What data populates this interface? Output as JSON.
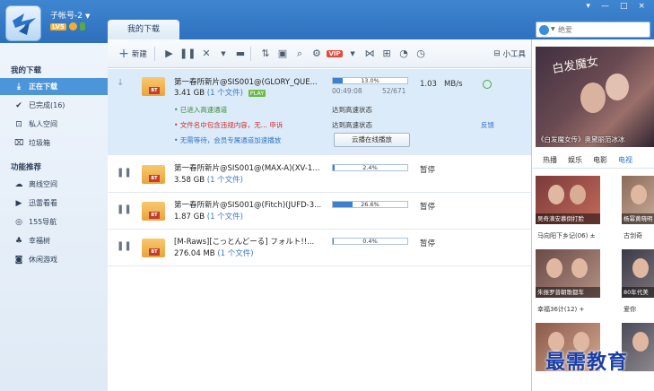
{
  "account": {
    "name": "子帐号-2",
    "level_badge": "LV5"
  },
  "window_controls": [
    "▾",
    "—",
    "□",
    "×"
  ],
  "main_tab": "我的下载",
  "search": {
    "placeholder": "绝爱"
  },
  "sidebar": {
    "section1_title": "我的下载",
    "items1": [
      {
        "label": "正在下载",
        "icon": "download-icon",
        "active": true
      },
      {
        "label": "已完成(16)",
        "icon": "check-icon",
        "active": false
      },
      {
        "label": "私人空间",
        "icon": "lock-icon",
        "active": false
      },
      {
        "label": "垃圾箱",
        "icon": "trash-icon",
        "active": false
      }
    ],
    "section2_title": "功能推荐",
    "items2": [
      {
        "label": "离线空间",
        "icon": "cloud-icon"
      },
      {
        "label": "迅雷看看",
        "icon": "play-circle-icon"
      },
      {
        "label": "155导航",
        "icon": "navigation-icon"
      },
      {
        "label": "幸福树",
        "icon": "tree-icon"
      },
      {
        "label": "休闲游戏",
        "icon": "gamepad-icon"
      }
    ]
  },
  "toolbar": {
    "new_label": "新建",
    "tools_label": "小工具",
    "vip_label": "VIP"
  },
  "downloads": [
    {
      "name": "第一春所新片@SIS001@(GLORY_QUE...",
      "size": "3.41 GB",
      "files": "(1 个文件)",
      "play_badge": "PLAY",
      "progress_text": "13.0%",
      "progress": 0.13,
      "elapsed": "00:49:08",
      "pieces": "52/671",
      "speed": "1.03",
      "speed_unit": "MB/s",
      "state_icon": "down-arrow-icon",
      "details": [
        {
          "text": "• 已进入高速通道",
          "right": "达到高速状态"
        },
        {
          "text": "• 文件名中包含违规内容，无... 申诉",
          "right": "达到高速状态",
          "extra": "反馈"
        },
        {
          "text": "• 无需等待，会员专属通道加速播放",
          "button": "云播在线播放"
        }
      ]
    },
    {
      "name": "第一春所新片@SIS001@(MAX-A)(XV-1...",
      "size": "3.58 GB",
      "files": "(1 个文件)",
      "progress_text": "2.4%",
      "progress": 0.024,
      "status": "暂停"
    },
    {
      "name": "第一春所新片@SIS001@(Fitch)(JUFD-3...",
      "size": "1.87 GB",
      "files": "(1 个文件)",
      "progress_text": "26.6%",
      "progress": 0.266,
      "status": "暂停"
    },
    {
      "name": "[M-Raws][こっとんどーる] フォルト!!...",
      "size": "276.04 MB",
      "files": "(1 个文件)",
      "progress_text": "0.4%",
      "progress": 0.004,
      "status": "暂停"
    }
  ],
  "right_panel": {
    "banner_caption": "《白发魔女传》奥黛丽范冰冰",
    "banner_title": "白发魔女",
    "tabs": [
      "热播",
      "娱乐",
      "电影",
      "电视"
    ],
    "active_tab": 3,
    "thumbs": [
      {
        "caption": "吴奇滴安慕倒打脸"
      },
      {
        "caption": "杨幂黄晓明"
      },
      {
        "caption": "朱振罗普朝歌都车"
      },
      {
        "caption": "80年代美"
      },
      {
        "caption": ""
      },
      {
        "caption": ""
      }
    ],
    "texts": [
      {
        "t": "马向阳下乡记(06) ±"
      },
      {
        "t": "古剑奇"
      },
      {
        "t": "幸福36计(12) +"
      },
      {
        "t": "爱你"
      }
    ]
  },
  "watermark": "最需教育"
}
